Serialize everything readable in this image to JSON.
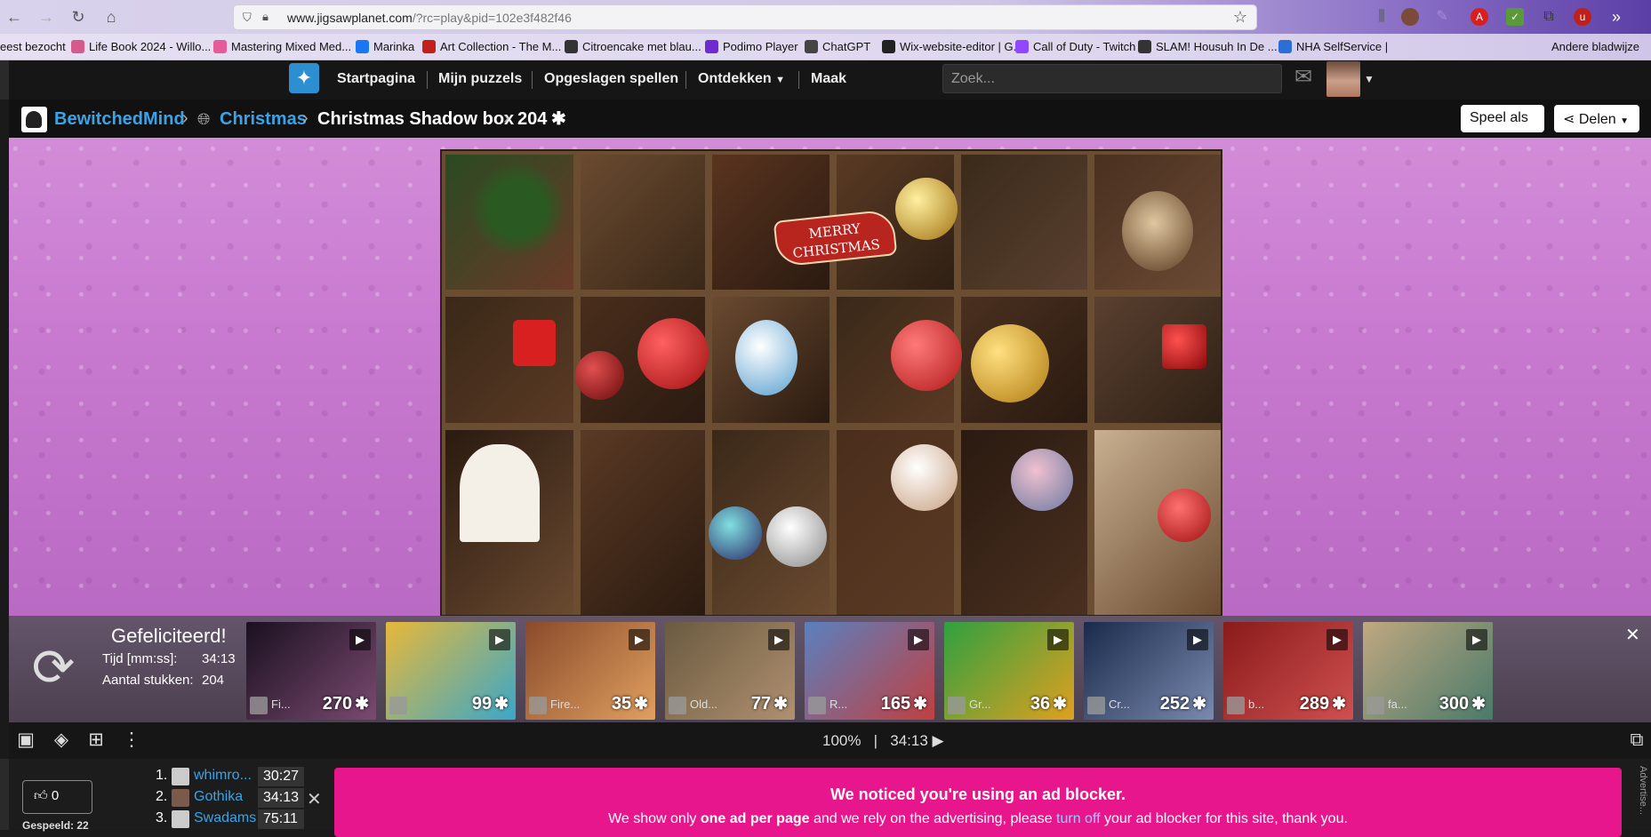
{
  "browser": {
    "url_host": "www.jigsawplanet.com",
    "url_path": "/?rc=play&pid=102e3f482f46",
    "bookmarks": [
      {
        "label": "eest bezocht",
        "color": ""
      },
      {
        "label": "Life Book 2024 - Willo...",
        "color": "#d65a8c"
      },
      {
        "label": "Mastering Mixed Med...",
        "color": "#e85b9a"
      },
      {
        "label": "Marinka",
        "color": "#1877f2"
      },
      {
        "label": "Art Collection - The M...",
        "color": "#c2201a"
      },
      {
        "label": "Citroencake met blau...",
        "color": "#333333"
      },
      {
        "label": "Podimo Player",
        "color": "#6f2bd1"
      },
      {
        "label": "ChatGPT",
        "color": "#444444"
      },
      {
        "label": "Wix-website-editor | G...",
        "color": "#222222"
      },
      {
        "label": "Call of Duty - Twitch",
        "color": "#9146ff"
      },
      {
        "label": "SLAM! Housuh In De ...",
        "color": "#333333"
      },
      {
        "label": "NHA SelfService |",
        "color": "#2a6fd6"
      },
      {
        "label": "Andere bladwijze",
        "color": ""
      }
    ]
  },
  "site": {
    "nav": [
      "Startpagina",
      "Mijn puzzels",
      "Opgeslagen spellen",
      "Ontdekken",
      "Maak"
    ],
    "search_placeholder": "Zoek..."
  },
  "breadcrumb": {
    "user": "BewitchedMind",
    "category": "Christmas",
    "puzzle": "Christmas Shadow box",
    "pieces": "204",
    "play_as": "Speel als",
    "share": "Delen"
  },
  "puzzle_image": {
    "sign_line1": "MERRY",
    "sign_line2": "CHRISTMAS"
  },
  "result": {
    "title": "Gefeliciteerd!",
    "time_label": "Tijd [mm:ss]:",
    "time_value": "34:13",
    "pieces_label": "Aantal stukken:",
    "pieces_value": "204"
  },
  "suggestions": [
    {
      "title": "Fi...",
      "count": "270",
      "colors": [
        "#1a1020",
        "#7a4a70"
      ]
    },
    {
      "title": "",
      "count": "99",
      "colors": [
        "#e8b83a",
        "#3aa7c8"
      ]
    },
    {
      "title": "Fire...",
      "count": "35",
      "colors": [
        "#8a4a2a",
        "#e0a060"
      ]
    },
    {
      "title": "Old...",
      "count": "77",
      "colors": [
        "#6a5a40",
        "#b09070"
      ]
    },
    {
      "title": "R...",
      "count": "165",
      "colors": [
        "#5a80c0",
        "#c04040"
      ]
    },
    {
      "title": "Gr...",
      "count": "36",
      "colors": [
        "#30a040",
        "#e0a020"
      ]
    },
    {
      "title": "Cr...",
      "count": "252",
      "colors": [
        "#1a2a4a",
        "#7a8ab0"
      ]
    },
    {
      "title": "b...",
      "count": "289",
      "colors": [
        "#8a1a1a",
        "#d05050"
      ]
    },
    {
      "title": "fa...",
      "count": "300",
      "colors": [
        "#c0a880",
        "#4a7a6a"
      ]
    }
  ],
  "toolbar": {
    "zoom": "100%",
    "timer": "34:13"
  },
  "bottom": {
    "likes": "0",
    "played_label": "Gespeeld: 22",
    "leaders": [
      {
        "rank": "1.",
        "name": "whimro...",
        "time": "30:27"
      },
      {
        "rank": "2.",
        "name": "Gothika",
        "time": "34:13"
      },
      {
        "rank": "3.",
        "name": "Swadams",
        "time": "75:11"
      }
    ],
    "ad_title": "We noticed you're using an ad blocker.",
    "ad_text_1": "We show only ",
    "ad_text_bold": "one ad per page",
    "ad_text_2": " and we rely on the advertising, please ",
    "ad_link": "turn off",
    "ad_text_3": " your ad blocker for this site, thank you.",
    "advert_label": "Advertise..."
  }
}
